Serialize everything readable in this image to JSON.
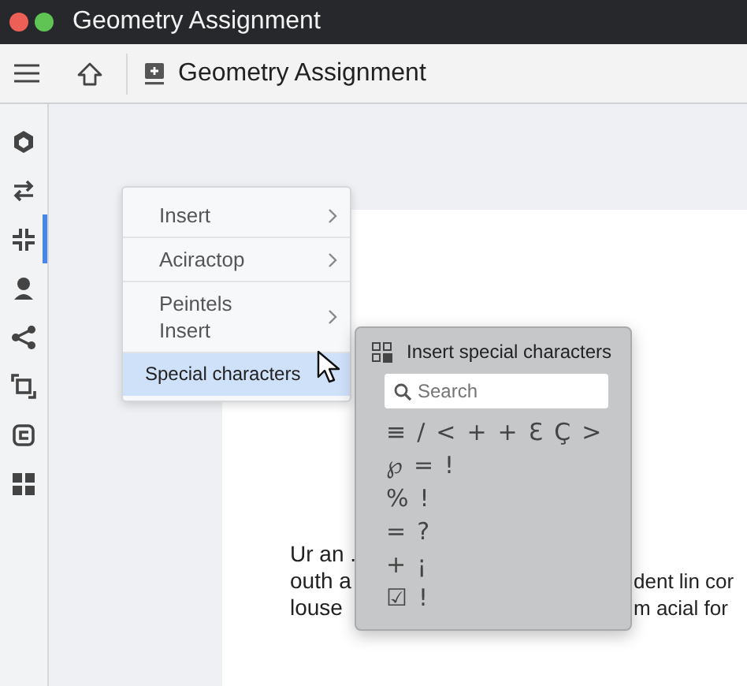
{
  "window": {
    "title": "Geometry Assignment"
  },
  "toolbar": {
    "document_title": "Geometry Assignment"
  },
  "sidebar": {
    "items": [
      {
        "selected": false
      },
      {
        "selected": false
      },
      {
        "selected": true
      },
      {
        "selected": false
      },
      {
        "selected": false
      },
      {
        "selected": false
      },
      {
        "selected": false
      },
      {
        "selected": false
      }
    ]
  },
  "document": {
    "lines": [
      {
        "left": "Ur an ."
      },
      {
        "left": "outh a",
        "right": "dent lin cor"
      },
      {
        "left": "louse",
        "right": "m acial for"
      }
    ]
  },
  "context_menu": {
    "items": [
      {
        "label": "Insert",
        "submenu": true,
        "selected": false
      },
      {
        "label": "Aciractop",
        "submenu": true,
        "selected": false
      },
      {
        "label": "Peintels Insert",
        "submenu": true,
        "selected": false
      },
      {
        "label": "Special characters",
        "submenu": false,
        "selected": true
      }
    ]
  },
  "special_characters": {
    "title": "Insert special characters",
    "search": {
      "placeholder": "Search"
    },
    "rows": [
      [
        "≡",
        "/",
        "<",
        "+",
        "+",
        "Ɛ",
        "Ç",
        ">"
      ],
      [
        "℘",
        "=",
        "!"
      ],
      [
        "%",
        "!"
      ],
      [
        "=",
        "?"
      ],
      [
        "+",
        "¡"
      ],
      [
        "☑",
        "!"
      ]
    ]
  }
}
